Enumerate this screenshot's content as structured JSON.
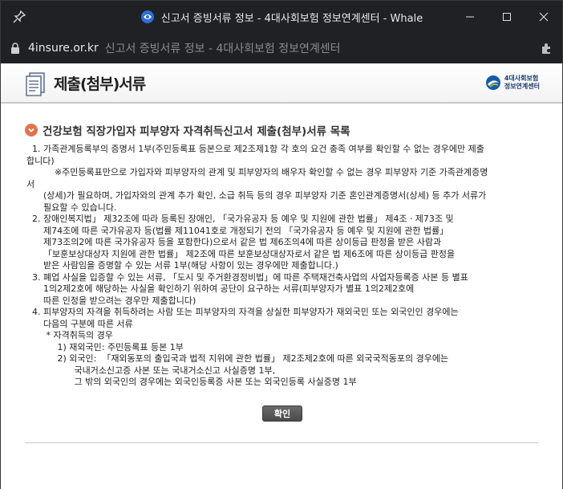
{
  "window": {
    "title": "신고서 증빙서류 정보 - 4대사회보험 정보연계센터 - Whale"
  },
  "address": {
    "domain": "4insure.or.kr",
    "page_title": "신고서 증빙서류 정보 - 4대사회보험 정보연계센터"
  },
  "header": {
    "title": "제출(첨부)서류",
    "org_line1": "4대사회보험",
    "org_line2": "정보연계센터"
  },
  "section": {
    "title": "건강보험 직장가입자 피부양자 자격취득신고서 제출(첨부)서류 목록"
  },
  "doc_lines": [
    "  1. 가족관계등록부의 증명서 1부(주민등록표 등본으로 제2조제1항 각 호의 요건 충족 여부를 확인할 수 없는 경우에만 제출",
    "합니다)",
    "          ※주민등록표만으로 가입자와 피부양자의 관계 및 피부양자의 배우자 확인할 수 없는 경우 피부양자 기준 가족관계증명",
    "서",
    "      (상세)가 필요하며, 가입자와의 관계 추가 확인, 소급 취득 등의 경우 피부양자 기준 혼인관계증명서(상세) 등 추가 서류가",
    "      필요할 수 있습니다.",
    "  2. 장애인복지법」 제32조에 따라 등록된 장애인, 「국가유공자 등 예우 및 지원에 관한 법률」 제4조ㆍ제73조 및",
    "      제74조에 따른 국가유공자 등(법률 제11041호로 개정되기 전의 「국가유공자 등 예우 및 지원에 관한 법률」",
    "      제73조의2에 따른 국가유공자 등을 포함한다)으로서 같은 법 제6조의4에 따른 상이등급 판정을 받은 사람과",
    "      「보훈보상대상자 지원에 관한 법률」 제2조에 따른 보훈보상대상자로서 같은 법 제6조에 따른 상이등급 판정을",
    "      받은 사람임을 증명할 수 있는 서류 1부(해당 사항이 있는 경우에만 제출합니다.)",
    "  3. 폐업 사실을 입증할 수 있는 서류, 「도시 및 주거환경정비법」에 따른 주택재건축사업의 사업자등록증 사본 등 별표",
    "      1의2제2호에 해당하는 사실을 확인하기 위하여 공단이 요구하는 서류(피부양자가 별표 1의2제2호에",
    "      따른 인정을 받으려는 경우만 제출합니다)",
    "  4. 피부양자의 자격을 취득하려는 사람 또는 피부양자의 자격을 상실한 피부양자가 재외국민 또는 외국인인 경우에는",
    "      다음의 구분에 따른 서류",
    "       * 자격취득의 경우",
    "           1) 재외국민: 주민등록표 등본 1부",
    "           2) 외국인:  「재외동포의 출입국과 법적 지위에 관한 법률」 제2조제2호에 따른 외국국적동포의 경우에는",
    "                 국내거소신고증 사본 또는 국내거소신고 사실증명 1부,",
    "                 그 밖의 외국인의 경우에는 외국인등록증 사본 또는 외국인등록 사실증명 1부"
  ],
  "buttons": {
    "confirm": "확인"
  },
  "colors": {
    "titlebar": "#202124",
    "accent_bullet": "#e2744a",
    "button": "#555555"
  }
}
